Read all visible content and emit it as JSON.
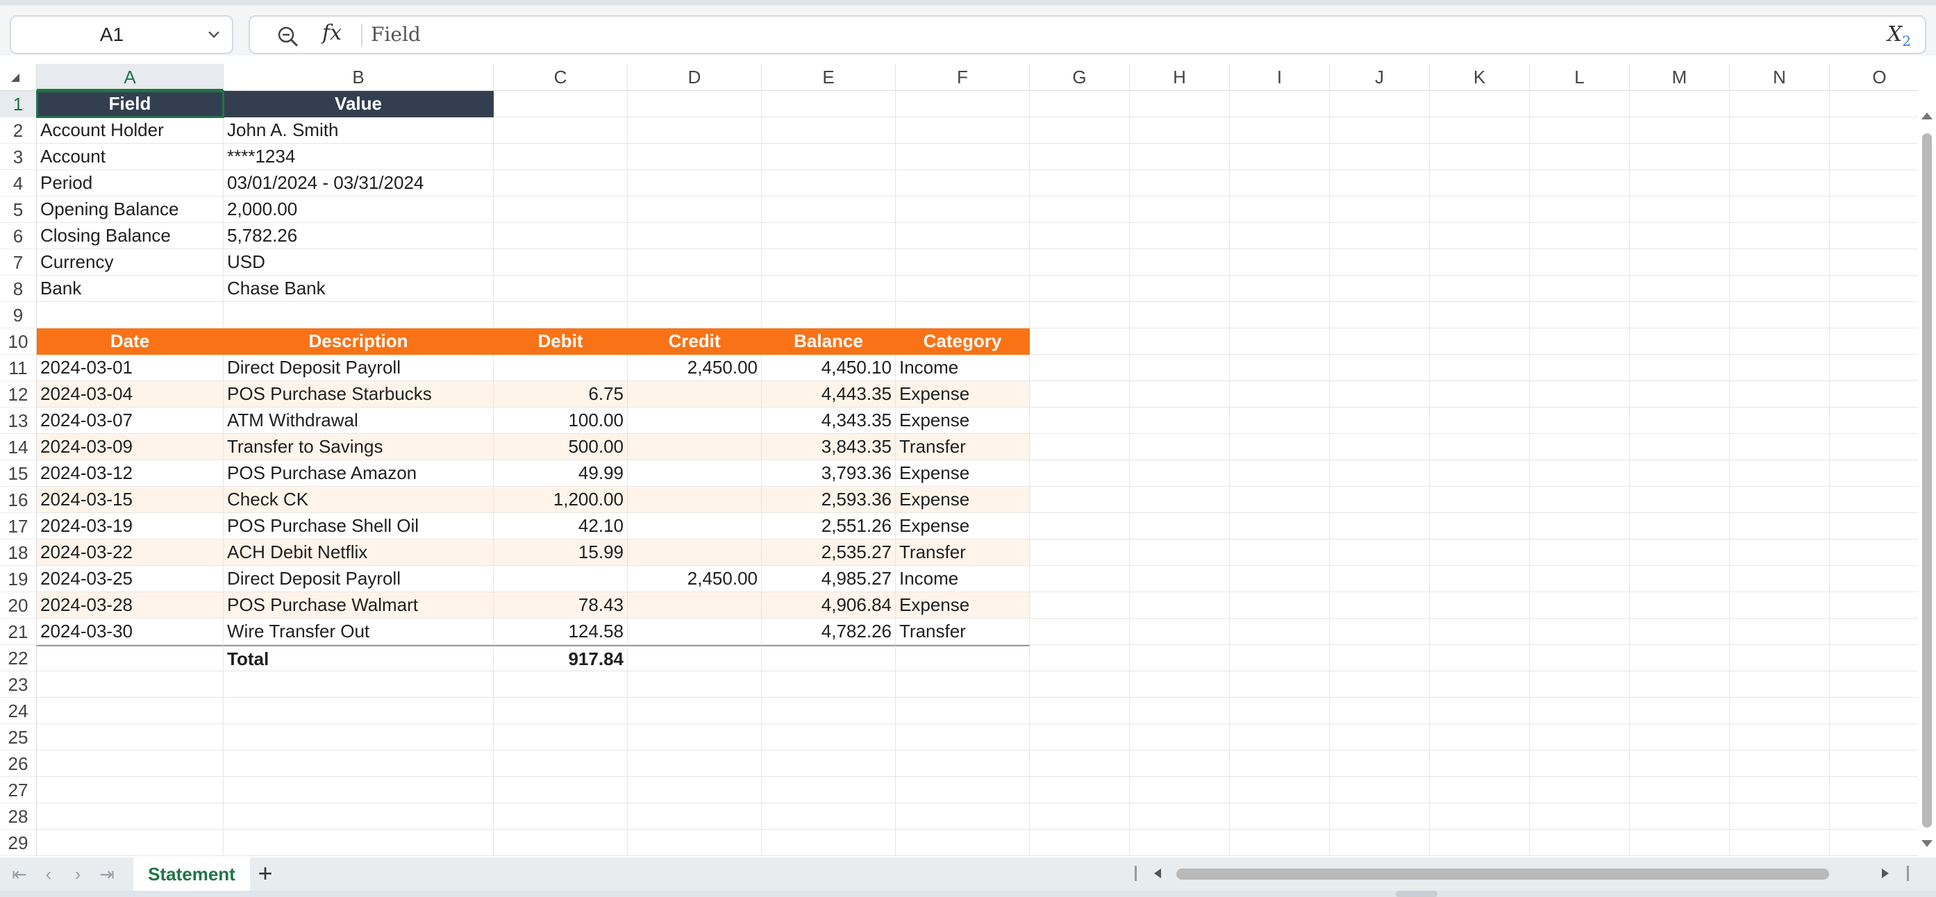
{
  "formula_bar": {
    "name_box": "A1",
    "formula_value": "Field"
  },
  "columns": [
    "A",
    "B",
    "C",
    "D",
    "E",
    "F",
    "G",
    "H",
    "I",
    "J",
    "K",
    "L",
    "M",
    "N",
    "O"
  ],
  "rows": [
    "1",
    "2",
    "3",
    "4",
    "5",
    "6",
    "7",
    "8",
    "9",
    "10",
    "11",
    "12",
    "13",
    "14",
    "15",
    "16",
    "17",
    "18",
    "19",
    "20",
    "21",
    "22",
    "23",
    "24",
    "25",
    "26",
    "27",
    "28",
    "29"
  ],
  "summary": {
    "header": [
      "Field",
      "Value"
    ],
    "items": [
      [
        "Account Holder",
        "John A. Smith"
      ],
      [
        "Account",
        "****1234"
      ],
      [
        "Period",
        "03/01/2024 - 03/31/2024"
      ],
      [
        "Opening Balance",
        "2,000.00"
      ],
      [
        "Closing Balance",
        "5,782.26"
      ],
      [
        "Currency",
        "USD"
      ],
      [
        "Bank",
        "Chase Bank"
      ]
    ]
  },
  "transactions": {
    "header": [
      "Date",
      "Description",
      "Debit",
      "Credit",
      "Balance",
      "Category"
    ],
    "rows": [
      [
        "2024-03-01",
        "Direct Deposit Payroll",
        "",
        "2,450.00",
        "4,450.10",
        "Income"
      ],
      [
        "2024-03-04",
        "POS Purchase Starbucks",
        "6.75",
        "",
        "4,443.35",
        "Expense"
      ],
      [
        "2024-03-07",
        "ATM Withdrawal",
        "100.00",
        "",
        "4,343.35",
        "Expense"
      ],
      [
        "2024-03-09",
        "Transfer to Savings",
        "500.00",
        "",
        "3,843.35",
        "Transfer"
      ],
      [
        "2024-03-12",
        "POS Purchase Amazon",
        "49.99",
        "",
        "3,793.36",
        "Expense"
      ],
      [
        "2024-03-15",
        "Check CK",
        "1,200.00",
        "",
        "2,593.36",
        "Expense"
      ],
      [
        "2024-03-19",
        "POS Purchase Shell Oil",
        "42.10",
        "",
        "2,551.26",
        "Expense"
      ],
      [
        "2024-03-22",
        "ACH Debit Netflix",
        "15.99",
        "",
        "2,535.27",
        "Transfer"
      ],
      [
        "2024-03-25",
        "Direct Deposit Payroll",
        "",
        "2,450.00",
        "4,985.27",
        "Income"
      ],
      [
        "2024-03-28",
        "POS Purchase Walmart",
        "78.43",
        "",
        "4,906.84",
        "Expense"
      ],
      [
        "2024-03-30",
        "Wire Transfer Out",
        "124.58",
        "",
        "4,782.26",
        "Transfer"
      ]
    ],
    "total_label": "Total",
    "total_debit": "917.84"
  },
  "sheet_tabs": [
    {
      "label": "Statement",
      "active": true
    }
  ],
  "colors": {
    "summary_header": "#333f50",
    "table_header": "#f97316",
    "band": "#fef4ea",
    "selection": "#217346"
  }
}
